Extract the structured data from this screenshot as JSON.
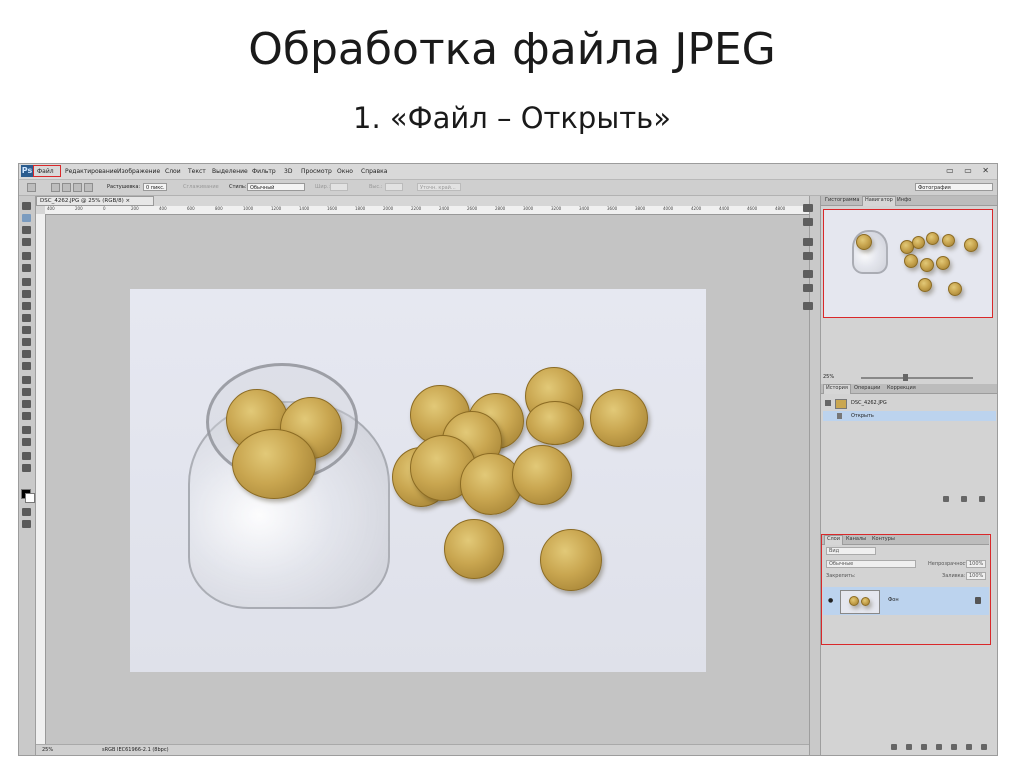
{
  "slide": {
    "title": "Обработка  файла JPEG",
    "subtitle": "1.  «Файл – Открыть»"
  },
  "app": {
    "logo": "Ps",
    "menu": [
      "Файл",
      "Редактирование",
      "Изображение",
      "Слои",
      "Текст",
      "Выделение",
      "Фильтр",
      "3D",
      "Просмотр",
      "Окно",
      "Справка"
    ],
    "window_controls": "▭ ▭ ✕",
    "workspace": "Фотография"
  },
  "options": {
    "feather_label": "Растушевка:",
    "feather_value": "0 пикс.",
    "antialias_label": "Сглаживание",
    "style_label": "Стиль:",
    "style_value": "Обычный",
    "width_label": "Шир.:",
    "height_label": "Выс.:",
    "refine_button": "Уточн. край..."
  },
  "document": {
    "tab_title": "DSC_4262.JPG @ 25% (RGB/8) ×",
    "ruler_ticks": [
      "400",
      "200",
      "0",
      "200",
      "400",
      "600",
      "800",
      "1000",
      "1200",
      "1400",
      "1600",
      "1800",
      "2000",
      "2200",
      "2400",
      "2600",
      "2800",
      "3000",
      "3200",
      "3400",
      "3600",
      "3800",
      "4000",
      "4200",
      "4400",
      "4600",
      "4800"
    ],
    "zoom": "25%",
    "status": "sRGB IEC61966-2.1 (8bpc)"
  },
  "panels": {
    "top_tabs": [
      "Гистограмма",
      "Навигатор",
      "Инфо"
    ],
    "navigator_zoom": "25%",
    "history_tabs": [
      "История",
      "Операции",
      "Коррекция"
    ],
    "history_items": [
      "DSC_4262.JPG",
      "Открыть"
    ],
    "layers_tabs": [
      "Слои",
      "Каналы",
      "Контуры"
    ],
    "layers_kind": "Вид",
    "layers_blend": "Обычные",
    "opacity_label": "Непрозрачность:",
    "opacity_value": "100%",
    "lock_label": "Закрепить:",
    "fill_label": "Заливка:",
    "fill_value": "100%",
    "layer_name": "Фон"
  },
  "colors": {
    "highlight": "#d9282a",
    "selected_row": "#bcd3ee",
    "coin": "#c9a650"
  }
}
